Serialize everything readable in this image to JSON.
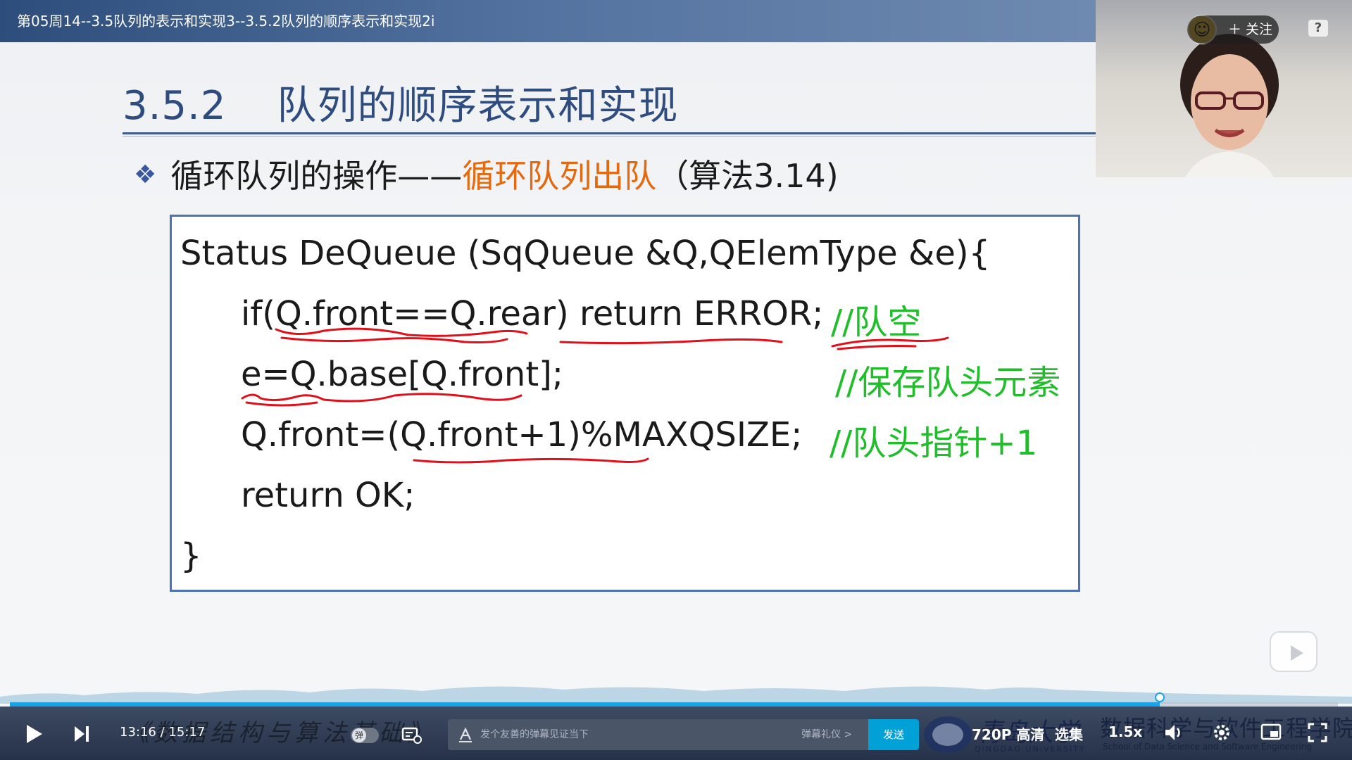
{
  "window": {
    "title": "第05周14--3.5队列的表示和实现3--3.5.2队列的顺序表示和实现2i"
  },
  "follow_button": {
    "label": "关注"
  },
  "slide": {
    "section_number": "3.5.2",
    "section_title": "队列的顺序表示和实现",
    "bullet_prefix": "循环队列的操作——",
    "bullet_highlight": "循环队列出队",
    "bullet_suffix": "（算法3.14)",
    "code": {
      "line1": "Status DeQueue (SqQueue &Q,QElemType &e){",
      "line2": "if(Q.front==Q.rear) return ERROR;",
      "line3": "e=Q.base[Q.front];",
      "line4": "Q.front=(Q.front+1)%MAXQSIZE;",
      "line5": "return OK;",
      "line6": "}"
    },
    "comments": {
      "c2": "//队空",
      "c3": "//保存队头元素",
      "c4": "//队头指针+1"
    }
  },
  "player": {
    "current_time": "13:16",
    "separator": "/",
    "duration": "15:17",
    "progress": 0.866,
    "course_watermark": "《数据结构与算法基础》",
    "danmu_toggle_glyph": "弹",
    "danmu_placeholder": "发个友善的弹幕见证当下",
    "danmu_etiquette": "弹幕礼仪 >",
    "send_label": "发送",
    "quality_label": "720P 高清",
    "episodes_label": "选集",
    "speed_label": "1.5x",
    "university_cn": "青岛大学",
    "university_en": "QINGDAO UNIVERSITY",
    "school_cn": "数据科学与软件工程学院",
    "school_en": "School of Data Science and Software Engineering"
  },
  "colors": {
    "heading": "#2f4c7e",
    "highlight": "#e46a12",
    "comment": "#1fbe2a",
    "annotation_ink": "#e0101a",
    "progress": "#1aa3e6"
  },
  "icons": [
    "help-icon",
    "play-icon",
    "next-icon",
    "danmu-settings-icon",
    "text-style-icon",
    "volume-icon",
    "settings-icon",
    "pip-icon",
    "fullscreen-icon",
    "mini-play-icon"
  ]
}
